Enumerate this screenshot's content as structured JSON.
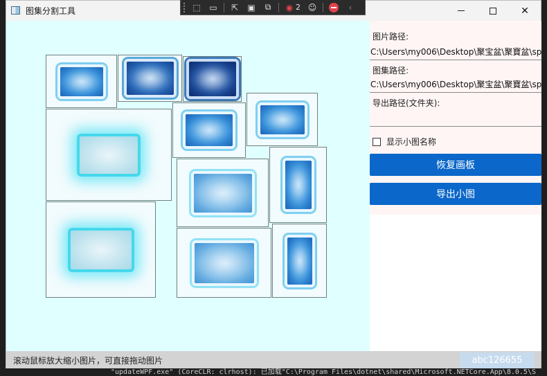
{
  "window": {
    "title": "图集分割工具"
  },
  "debug_toolbar": {
    "hot_reload_count": "2"
  },
  "panel": {
    "image_path_label": "图片路径:",
    "image_path_value": "C:\\Users\\my006\\Desktop\\聚宝盆\\聚寶盆\\spi",
    "atlas_path_label": "图集路径:",
    "atlas_path_value": "C:\\Users\\my006\\Desktop\\聚宝盆\\聚寶盆\\spi",
    "export_path_label": "导出路径(文件夹):",
    "export_path_value": "",
    "show_names_label": "显示小图名称",
    "show_names_checked": false,
    "reset_button": "恢复画板",
    "export_button": "导出小图"
  },
  "statusbar": {
    "hint": "滚动鼠标放大缩小图片，可直接拖动图片",
    "tag": "abc126655"
  },
  "background": {
    "console_line": "\"updateWPF.exe\" (CoreCLR: clrhost): 已加载\"C:\\Program Files\\dotnet\\shared\\Microsoft.NETCore.App\\8.0.5\\S"
  },
  "colors": {
    "canvas_bg": "#e0ffff",
    "accent": "#0b67c9",
    "panel_bg": "#fff5f5"
  },
  "icons": [
    "app-icon",
    "minimize-icon",
    "maximize-icon",
    "close-icon",
    "select-element-icon",
    "video-icon",
    "pointer-icon",
    "display-layout-icon",
    "track-focus-icon",
    "hot-reload-icon",
    "accessibility-icon",
    "stop-icon",
    "collapse-icon"
  ]
}
